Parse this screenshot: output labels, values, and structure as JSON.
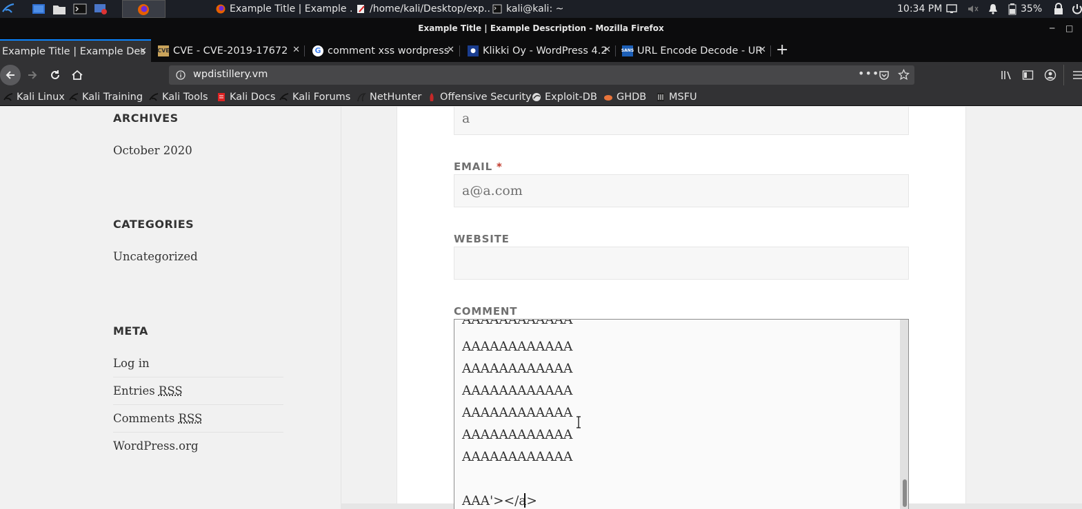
{
  "taskbar": {
    "windows": [
      {
        "title": "Example Title | Example ..."
      },
      {
        "title": "/home/kali/Desktop/exp...."
      },
      {
        "title": "kali@kali: ~"
      }
    ],
    "clock": "10:34 PM",
    "battery": "35%"
  },
  "window": {
    "title": "Example Title | Example Description - Mozilla Firefox"
  },
  "tabs": [
    {
      "label": "Example Title | Example Des",
      "favicon": "firefox-icon",
      "active": true
    },
    {
      "label": "CVE - CVE-2019-17672",
      "favicon": "cve-icon",
      "active": false
    },
    {
      "label": "comment xss wordpress",
      "favicon": "google-icon",
      "active": false
    },
    {
      "label": "Klikki Oy - WordPress 4.2",
      "favicon": "klikki-icon",
      "active": false
    },
    {
      "label": "URL Encode Decode - UR",
      "favicon": "sans-tools-icon",
      "active": false
    }
  ],
  "urlbar": {
    "url": "wpdistillery.vm"
  },
  "bookmarks": [
    {
      "label": "Kali Linux",
      "icon": "kali-icon"
    },
    {
      "label": "Kali Training",
      "icon": "kali-icon"
    },
    {
      "label": "Kali Tools",
      "icon": "kali-icon"
    },
    {
      "label": "Kali Docs",
      "icon": "kali-docs-icon"
    },
    {
      "label": "Kali Forums",
      "icon": "kali-icon"
    },
    {
      "label": "NetHunter",
      "icon": "nethunter-icon"
    },
    {
      "label": "Offensive Security",
      "icon": "offsec-icon"
    },
    {
      "label": "Exploit-DB",
      "icon": "exploitdb-icon"
    },
    {
      "label": "GHDB",
      "icon": "ghdb-icon"
    },
    {
      "label": "MSFU",
      "icon": "msfu-icon"
    }
  ],
  "sidebar": {
    "archives": {
      "title": "ARCHIVES",
      "items": [
        "October 2020"
      ]
    },
    "categories": {
      "title": "CATEGORIES",
      "items": [
        "Uncategorized"
      ]
    },
    "meta": {
      "title": "META",
      "items": {
        "login": "Log in",
        "entries_prefix": "Entries",
        "comments_prefix": "Comments",
        "rss": "RSS",
        "wordpress": "WordPress.org"
      }
    }
  },
  "form": {
    "name_value": "a",
    "email_label": "EMAIL",
    "required_mark": "*",
    "email_value": "a@a.com",
    "website_label": "WEBSITE",
    "website_value": "",
    "comment_label": "COMMENT",
    "comment_lines": [
      "AAAAAAAAAAAA",
      "AAAAAAAAAAAA",
      "AAAAAAAAAAAA",
      "AAAAAAAAAAAA",
      "AAAAAAAAAAAA",
      "AAAAAAAAAAAA",
      "AAAAAAAAAAAA",
      "",
      "AAA'></a>"
    ]
  },
  "colors": {
    "accent": "#0a84ff",
    "required": "#c0392b",
    "taskbar": "#1c1f26",
    "toolbar": "#323234"
  }
}
